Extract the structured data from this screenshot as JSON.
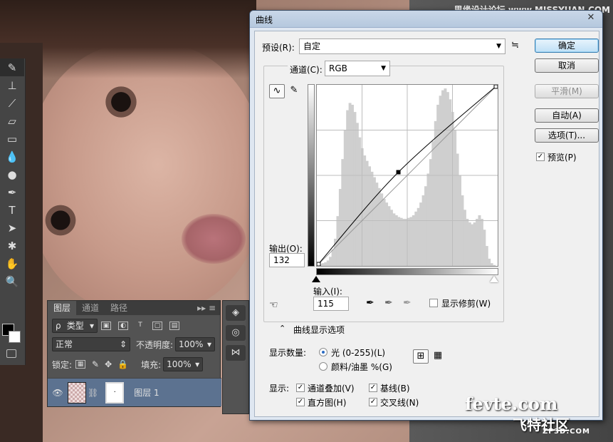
{
  "watermark_top": "思缘设计论坛 www.MISSYUAN.COM",
  "watermarks": {
    "fevte": "fevte.com",
    "site_cn": "飞特社区",
    "site_en": "ZF3D.COM"
  },
  "dialog": {
    "title": "曲线",
    "preset_label": "预设(R):",
    "preset_value": "自定",
    "channel_label": "通道(C):",
    "channel_value": "RGB",
    "output_label": "输出(O):",
    "output_value": "132",
    "input_label": "输入(I):",
    "input_value": "115",
    "show_clipping_label": "显示修剪(W)",
    "show_clipping": false,
    "curve_display_options": "曲线显示选项",
    "show_amount_label": "显示数量:",
    "amount_light": "光 (0-255)(L)",
    "amount_pigment": "颜料/油墨 %(G)",
    "amount_selected": "light",
    "show_label": "显示:",
    "show_options": [
      {
        "label": "通道叠加(V)",
        "checked": true
      },
      {
        "label": "基线(B)",
        "checked": true
      },
      {
        "label": "直方图(H)",
        "checked": true
      },
      {
        "label": "交叉线(N)",
        "checked": true
      }
    ],
    "buttons": {
      "ok": "确定",
      "cancel": "取消",
      "smooth": "平滑(M)",
      "auto": "自动(A)",
      "options": "选项(T)..."
    },
    "preview_label": "预览(P)",
    "preview": true
  },
  "curve": {
    "input_range": [
      0,
      255
    ],
    "output_range": [
      0,
      255
    ],
    "points": [
      [
        0,
        0
      ],
      [
        115,
        132
      ],
      [
        255,
        255
      ]
    ]
  },
  "histogram": [
    2,
    2,
    3,
    4,
    6,
    10,
    18,
    30,
    55,
    85,
    118,
    150,
    172,
    180,
    178,
    170,
    158,
    142,
    130,
    122,
    116,
    110,
    104,
    98,
    92,
    86,
    80,
    74,
    70,
    66,
    62,
    58,
    56,
    54,
    53,
    52,
    52,
    53,
    54,
    56,
    60,
    64,
    70,
    78,
    88,
    102,
    118,
    138,
    160,
    178,
    188,
    194,
    196,
    192,
    184,
    170,
    150,
    124,
    100,
    78,
    62,
    52,
    48,
    46,
    48,
    52,
    56,
    52,
    40,
    22,
    8,
    3,
    1,
    0
  ],
  "layers_panel": {
    "tabs": [
      "图层",
      "通道",
      "路径"
    ],
    "filter_value": "类型",
    "blend_mode": "正常",
    "opacity_label": "不透明度:",
    "opacity_value": "100%",
    "lock_label": "锁定:",
    "fill_label": "填充:",
    "fill_value": "100%",
    "layer_name": "图层 1"
  }
}
